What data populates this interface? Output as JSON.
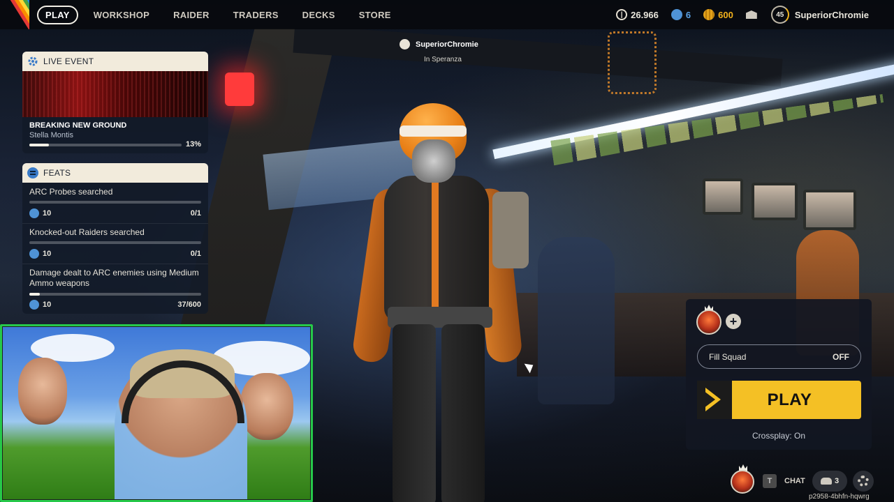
{
  "topbar": {
    "nav": [
      {
        "label": "PLAY",
        "active": true
      },
      {
        "label": "WORKSHOP"
      },
      {
        "label": "RAIDER"
      },
      {
        "label": "TRADERS"
      },
      {
        "label": "DECKS"
      },
      {
        "label": "STORE"
      }
    ],
    "currencies": {
      "credits": "26.966",
      "tokens": "6",
      "coins": "600"
    },
    "level": "45",
    "username": "SuperiorChromie",
    "icons": {
      "credits": "credits-icon",
      "tokens": "raider-token-icon",
      "coins": "coin-icon",
      "mail": "mail-icon"
    }
  },
  "live_event": {
    "header": "LIVE EVENT",
    "title": "BREAKING NEW GROUND",
    "subtitle": "Stella Montis",
    "progress_label": "13%",
    "progress_fraction": 0.13
  },
  "feats": {
    "header": "FEATS",
    "items": [
      {
        "label": "ARC Probes searched",
        "reward": "10",
        "count": "0/1",
        "progress_fraction": 0
      },
      {
        "label": "Knocked-out Raiders searched",
        "reward": "10",
        "count": "0/1",
        "progress_fraction": 0
      },
      {
        "label": "Damage dealt to ARC enemies using Medium Ammo weapons",
        "reward": "10",
        "count": "37/600",
        "progress_fraction": 0.06
      }
    ]
  },
  "nameplate": {
    "name": "SuperiorChromie",
    "location": "In Speranza"
  },
  "squad": {
    "fill_squad_label": "Fill Squad",
    "fill_squad_state": "OFF",
    "play_label": "PLAY",
    "crossplay": "Crossplay: On"
  },
  "bottom_bar": {
    "t_key": "T",
    "chat_label": "CHAT",
    "friends_count": "3",
    "lobby_code": "p2958-4bhfn-hqwrg"
  },
  "colors": {
    "accent_yellow": "#f4c025",
    "panel_header": "#f2ebdc",
    "token_blue": "#4f93d6",
    "coin_gold": "#f3b21c"
  }
}
